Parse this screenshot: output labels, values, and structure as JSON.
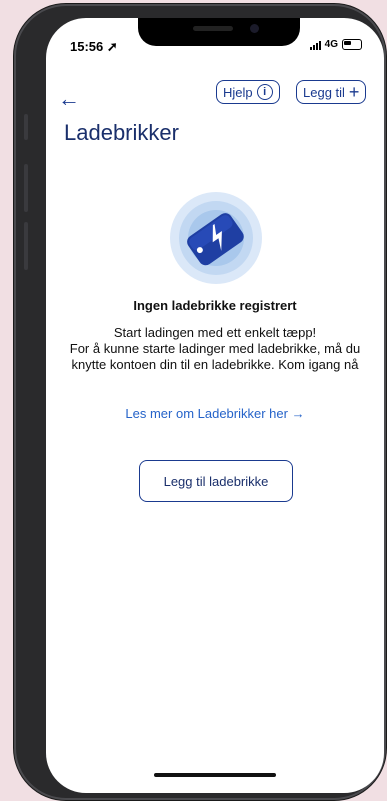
{
  "status": {
    "time": "15:56",
    "network": "4G"
  },
  "header": {
    "help_label": "Hjelp",
    "add_label": "Legg til",
    "title": "Ladebrikker"
  },
  "empty_state": {
    "title": "Ingen ladebrikke registrert",
    "line1": "Start ladingen med ett enkelt tæpp!",
    "line2": "For å kunne starte ladinger med ladebrikke, må du knytte kontoen din til en ladebrikke. Kom igang nå",
    "link": "Les mer om Ladebrikker her",
    "button": "Legg til ladebrikke"
  },
  "colors": {
    "primary": "#1a3a8f",
    "link": "#2563c9",
    "tag": "#1f3fa3"
  },
  "icons": [
    "back-arrow-icon",
    "info-icon",
    "plus-icon",
    "charging-tag-icon",
    "arrow-right-icon"
  ]
}
